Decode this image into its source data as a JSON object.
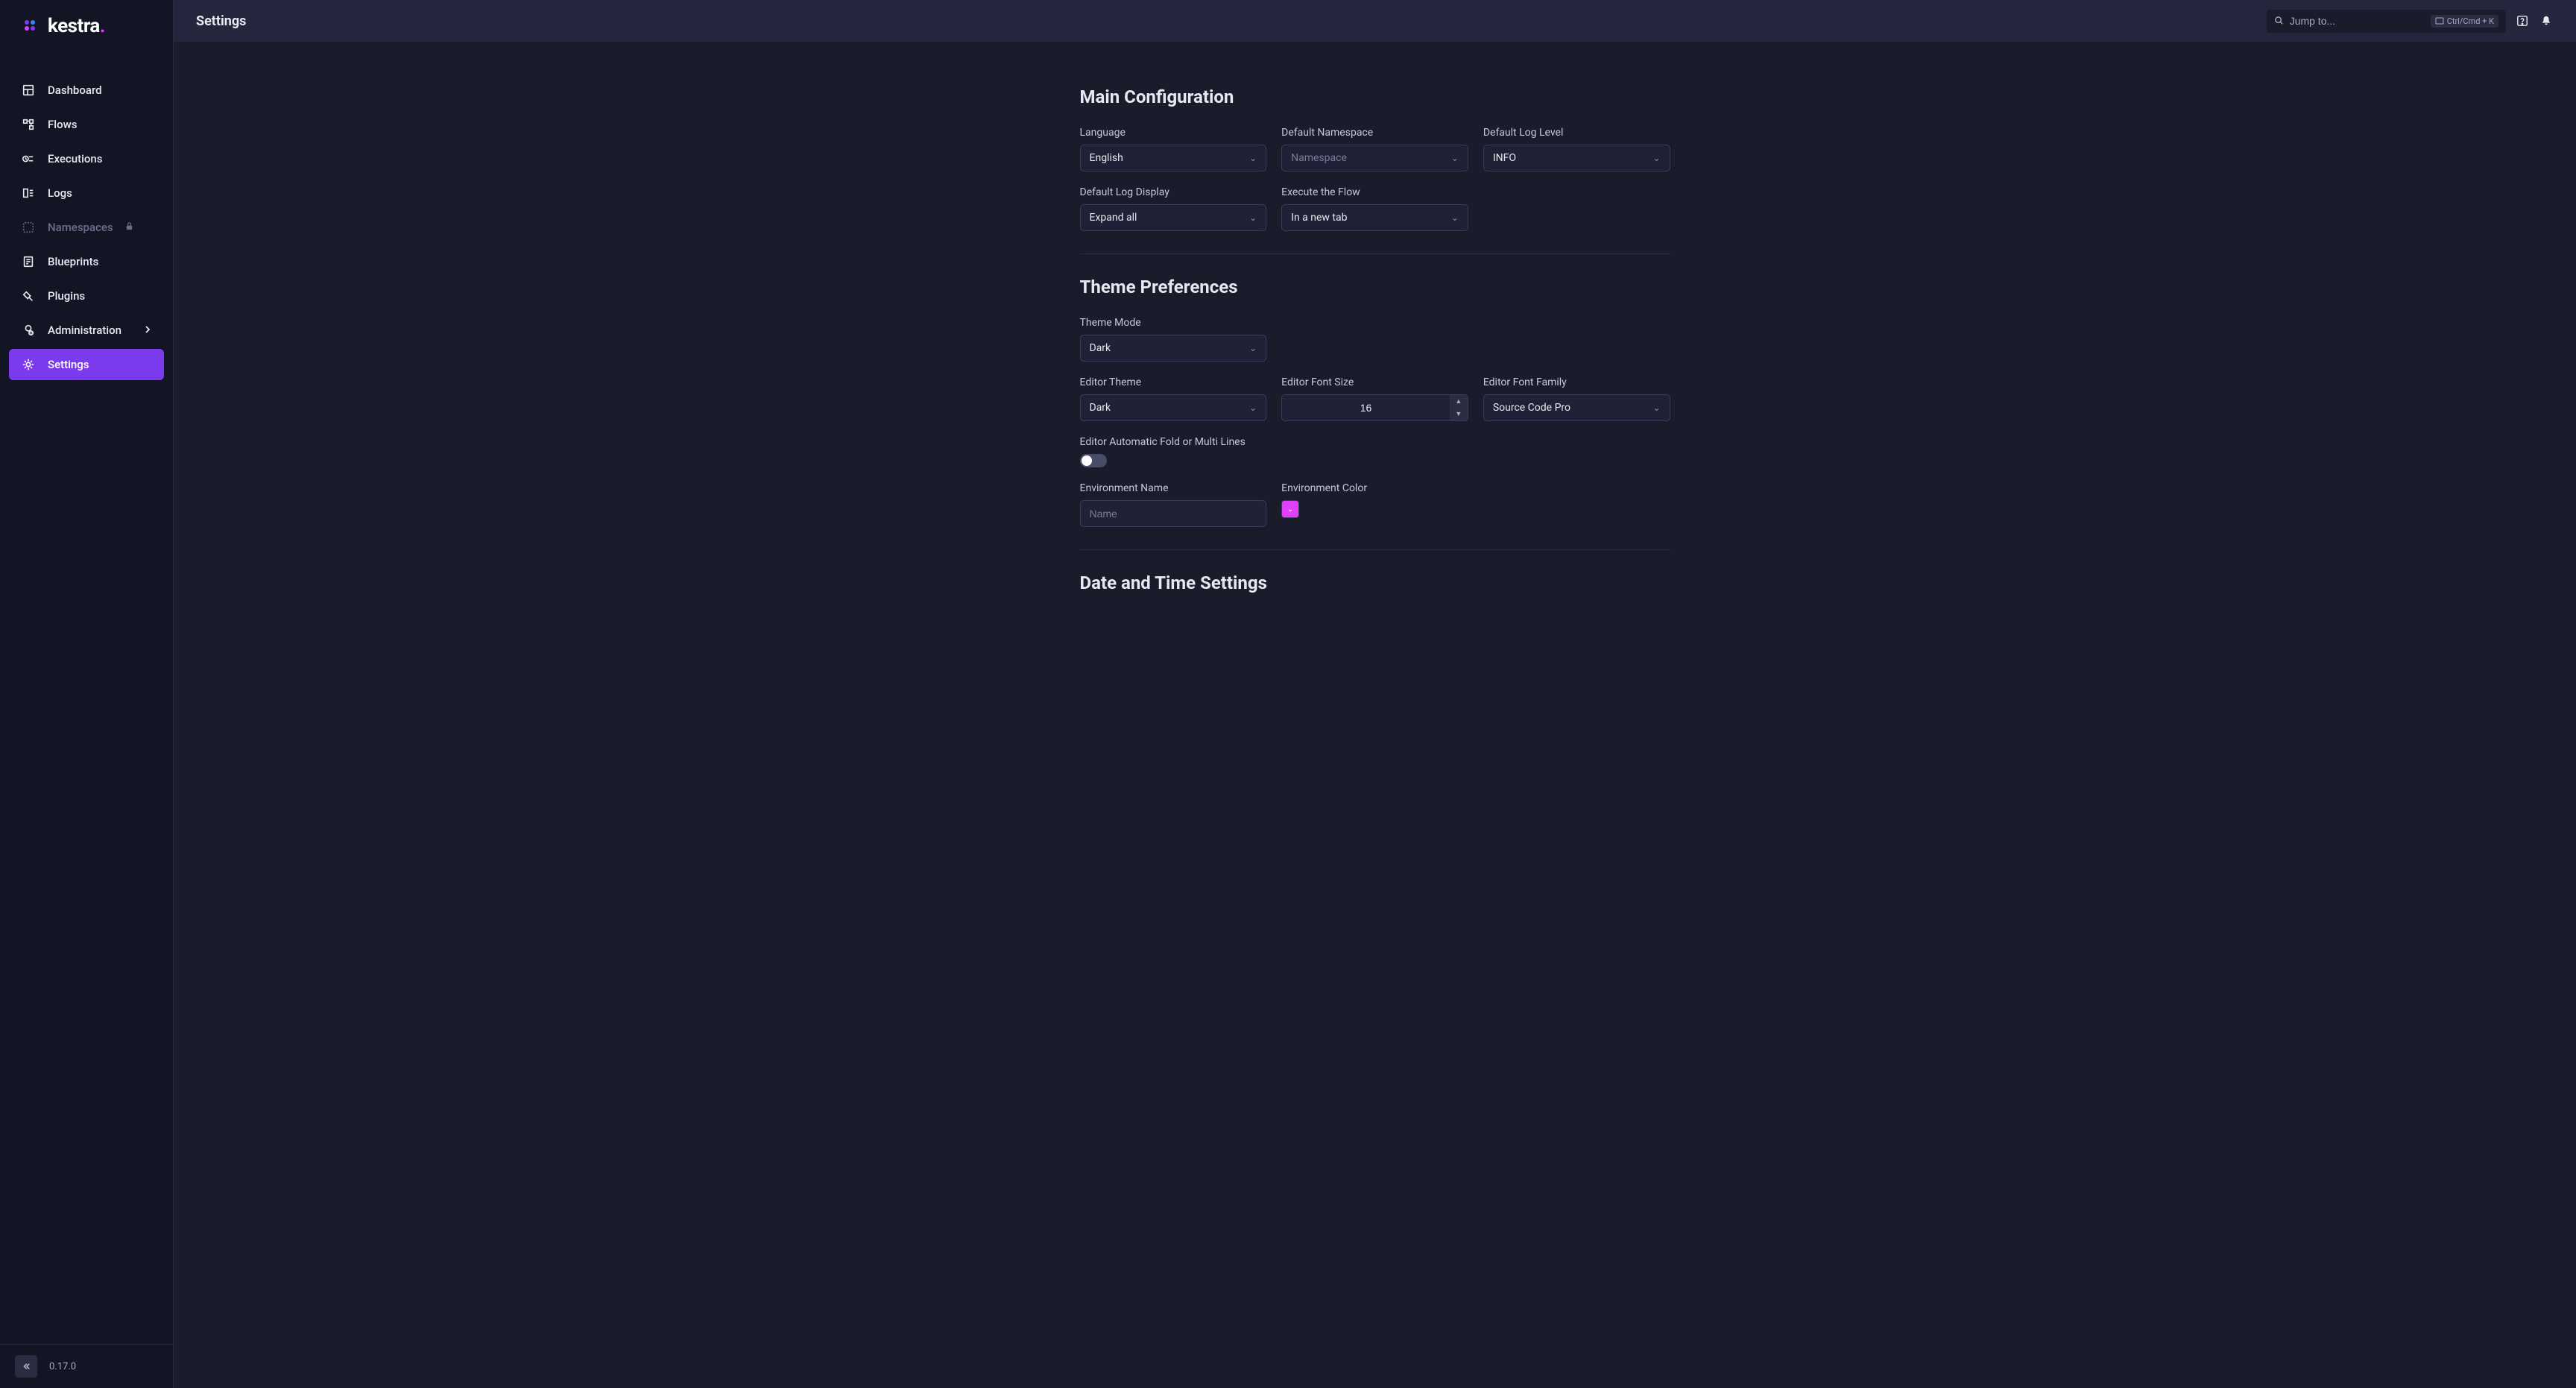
{
  "app": {
    "name": "kestra",
    "version": "0.17.0"
  },
  "sidebar": {
    "items": [
      {
        "label": "Dashboard",
        "icon": "dashboard"
      },
      {
        "label": "Flows",
        "icon": "flows"
      },
      {
        "label": "Executions",
        "icon": "executions"
      },
      {
        "label": "Logs",
        "icon": "logs"
      },
      {
        "label": "Namespaces",
        "icon": "namespaces",
        "locked": true
      },
      {
        "label": "Blueprints",
        "icon": "blueprints"
      },
      {
        "label": "Plugins",
        "icon": "plugins"
      },
      {
        "label": "Administration",
        "icon": "administration",
        "expandable": true
      },
      {
        "label": "Settings",
        "icon": "settings",
        "active": true
      }
    ]
  },
  "topbar": {
    "title": "Settings",
    "search_placeholder": "Jump to...",
    "shortcut": "Ctrl/Cmd + K"
  },
  "sections": {
    "main": {
      "title": "Main Configuration",
      "fields": {
        "language": {
          "label": "Language",
          "value": "English"
        },
        "namespace": {
          "label": "Default Namespace",
          "placeholder": "Namespace"
        },
        "log_level": {
          "label": "Default Log Level",
          "value": "INFO"
        },
        "log_display": {
          "label": "Default Log Display",
          "value": "Expand all"
        },
        "execute_flow": {
          "label": "Execute the Flow",
          "value": "In a new tab"
        }
      }
    },
    "theme": {
      "title": "Theme Preferences",
      "fields": {
        "theme_mode": {
          "label": "Theme Mode",
          "value": "Dark"
        },
        "editor_theme": {
          "label": "Editor Theme",
          "value": "Dark"
        },
        "editor_font_size": {
          "label": "Editor Font Size",
          "value": "16"
        },
        "editor_font_family": {
          "label": "Editor Font Family",
          "value": "Source Code Pro"
        },
        "editor_fold": {
          "label": "Editor Automatic Fold or Multi Lines"
        },
        "env_name": {
          "label": "Environment Name",
          "placeholder": "Name"
        },
        "env_color": {
          "label": "Environment Color",
          "value": "#e040fb"
        }
      }
    },
    "datetime": {
      "title": "Date and Time Settings"
    }
  }
}
